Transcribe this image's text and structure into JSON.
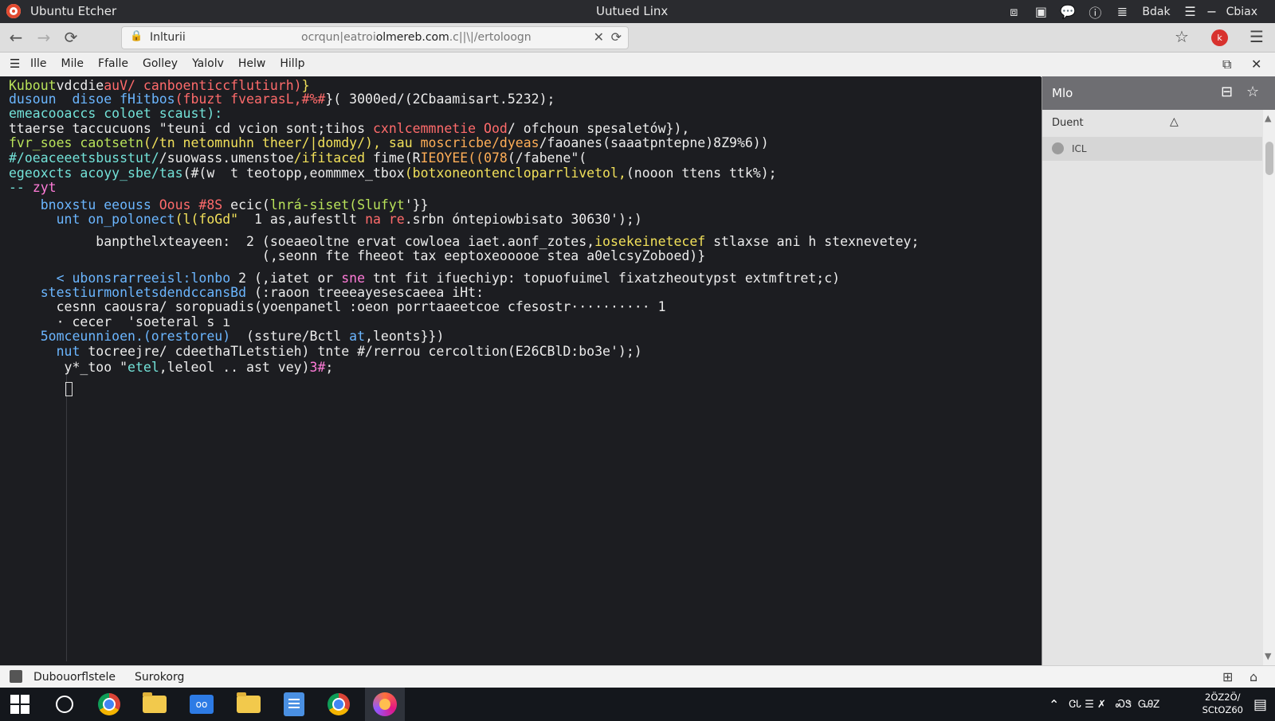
{
  "titlebar": {
    "app_title": "Ubuntu Etcher",
    "center_title": "Uutued Linx",
    "icons": [
      "window-restore-icon",
      "snap-icon",
      "chat-icon",
      "info-icon",
      "list-icon"
    ],
    "text1": "Bdak",
    "icon_list": "☰",
    "dash": "−",
    "text2": "Cbiax"
  },
  "navbar": {
    "back": "←",
    "forward": "→",
    "reload": "⟳",
    "lock": "🔒",
    "tab_label": "Inlturii",
    "url_prefix": "ocrqun|eatroi",
    "url_domain": "olmereb.com",
    "url_suffix": ".c||\\|/ertoloogn",
    "url_close": "✕",
    "url_reload": "⟳",
    "star": "☆",
    "badge": "k",
    "menu": "☰"
  },
  "menubar": {
    "icon": "☰",
    "items": [
      "Ille",
      "Mile",
      "Ffalle",
      "Golley",
      "Yalolv",
      "Helw",
      "Hillp"
    ],
    "right_icons": [
      "⧉",
      "✕"
    ]
  },
  "terminal": {
    "lines": [
      [
        {
          "t": "Kubout",
          "c": "c-g"
        },
        {
          "t": "vdcdie",
          "c": "c-w"
        },
        {
          "t": "auV/ canboenticcflutiurh)",
          "c": "c-r"
        },
        {
          "t": "}",
          "c": "c-y"
        }
      ],
      [
        {
          "t": "dusoun  disoe ",
          "c": "c-b"
        },
        {
          "t": "fHitbos",
          "c": "c-b"
        },
        {
          "t": "(fbuzt fvearasL,#%#",
          "c": "c-r"
        },
        {
          "t": "}( 3000ed/(2Cbaamisart.5232);",
          "c": "c-w"
        }
      ],
      [
        {
          "t": "emeacooaccs coloet scaust):",
          "c": "c-c"
        }
      ],
      [
        {
          "t": "ttaerse taccucuons \"teuni cd vcion sont;tihos ",
          "c": "c-w"
        },
        {
          "t": "cxnlcemmnetie Ood",
          "c": "c-r"
        },
        {
          "t": "/ ofchoun spesaletów}),",
          "c": "c-w"
        }
      ],
      [
        {
          "t": "fvr_soes caotsetn",
          "c": "c-g"
        },
        {
          "t": "(/tn netomnuhn theer/|domdy/), sau ",
          "c": "c-y"
        },
        {
          "t": "moscricbe/dyeas",
          "c": "c-o"
        },
        {
          "t": "/faoanes(saaatpntepne)8Z9%6))",
          "c": "c-w"
        }
      ],
      [
        {
          "t": "#/oeaceeetsbusstut/",
          "c": "c-c"
        },
        {
          "t": "/suowass.umenstoe",
          "c": "c-w"
        },
        {
          "t": "/ifitaced ",
          "c": "c-y"
        },
        {
          "t": "fime(R",
          "c": "c-w"
        },
        {
          "t": "IEOYEE((078",
          "c": "c-o"
        },
        {
          "t": "(/fabene\"(",
          "c": "c-w"
        }
      ],
      [
        {
          "t": "egeoxcts acoyy_sbe/tas",
          "c": "c-c"
        },
        {
          "t": "(#(w  t teotopp,eommmex_tbox",
          "c": "c-w"
        },
        {
          "t": "(botxoneontencloparrlivetol,",
          "c": "c-y"
        },
        {
          "t": "(nooon ttens ttk%);",
          "c": "c-w"
        }
      ],
      [
        {
          "t": "-- ",
          "c": "c-c"
        },
        {
          "t": "zyt",
          "c": "c-m"
        }
      ],
      [
        {
          "t": "    bnoxstu eeouss ",
          "c": "c-b"
        },
        {
          "t": "Oous #8S ",
          "c": "c-r"
        },
        {
          "t": "ecic(",
          "c": "c-w"
        },
        {
          "t": "lnrá-siset(Slufyt",
          "c": "c-g"
        },
        {
          "t": "'}}",
          "c": "c-w"
        }
      ],
      [
        {
          "t": "      unt on_polonect",
          "c": "c-b"
        },
        {
          "t": "(l(foGd\"",
          "c": "c-y"
        },
        {
          "t": "  1 as,aufestlt ",
          "c": "c-w"
        },
        {
          "t": "na re",
          "c": "c-r"
        },
        {
          "t": ".srbn óntepiowbisato 30630');)",
          "c": "c-w"
        }
      ],
      [
        {
          "t": "           banpthelxteayeen:  2 (soeaeoltne ervat cowloea iaet.aonf_zotes,",
          "c": "c-w"
        },
        {
          "t": "iosekeinetecef ",
          "c": "c-y"
        },
        {
          "t": "stlaxse ani h stexnevetey;",
          "c": "c-w"
        }
      ],
      [
        {
          "t": "                                (,seonn fte fheeot tax eeptoxeooooe stea a0elcsyZoboed)}",
          "c": "c-w"
        }
      ],
      [
        {
          "t": "      < ubonsrarreeisl:lonbo ",
          "c": "c-b"
        },
        {
          "t": "2 (,iatet or ",
          "c": "c-w"
        },
        {
          "t": "sne",
          "c": "c-m"
        },
        {
          "t": " tnt fit ifuechiyp: topuofuimel fixatzheoutypst extmftret;c)",
          "c": "c-w"
        }
      ],
      [
        {
          "t": "    stestiurmonletsdendccansBd",
          "c": "c-b"
        },
        {
          "t": " (:raoon treeeayesescaeea iHt:",
          "c": "c-w"
        }
      ],
      [
        {
          "t": "      cesnn caousra/ soropuadis(yoenpanetl :oeon porrtaaeetcoe cfesostr·········· 1",
          "c": "c-w"
        }
      ],
      [
        {
          "t": "      · cecer  'soeteral s ı",
          "c": "c-w"
        }
      ],
      [
        {
          "t": "    5omceunnioen.(orestoreu)",
          "c": "c-b"
        },
        {
          "t": "  (ssture/Bctl ",
          "c": "c-w"
        },
        {
          "t": "at",
          "c": "c-b"
        },
        {
          "t": ",leonts}})",
          "c": "c-w"
        }
      ],
      [
        {
          "t": "      nut ",
          "c": "c-b"
        },
        {
          "t": "tocreejre/ cdeethaTLetstieh) tnte #/rerrou cercoltion(E26CBlD:bo3e');)",
          "c": "c-w"
        }
      ],
      [
        {
          "t": "       y*_too \"",
          "c": "c-w"
        },
        {
          "t": "etel",
          "c": "c-c"
        },
        {
          "t": ",leleol .. ast vey)",
          "c": "c-w"
        },
        {
          "t": "3#",
          "c": "c-m"
        },
        {
          "t": ";",
          "c": "c-w"
        }
      ]
    ]
  },
  "sidepanel": {
    "title": "Mlo",
    "header_icons": [
      "⊟",
      "☆"
    ],
    "row1_label": "Duent",
    "row1_icon": "△",
    "row2_label": "ICL",
    "scroll_up": "▲",
    "scroll_down": "▼"
  },
  "statusbar": {
    "left": "Dubouorflstele",
    "left2": "Surokorg",
    "right_icons": [
      "⊞",
      "⌂"
    ]
  },
  "taskbar": {
    "tray_up": "⌃",
    "tray_icons": "ᏣᏓ ☰ ✗",
    "tray_text1": "ᏍᏕ",
    "tray_text2": "ᏀᎯᏃ",
    "clock_line1": "2ÖZ2Ö/",
    "clock_line2": "SCtOZ60",
    "notif": "▤"
  }
}
